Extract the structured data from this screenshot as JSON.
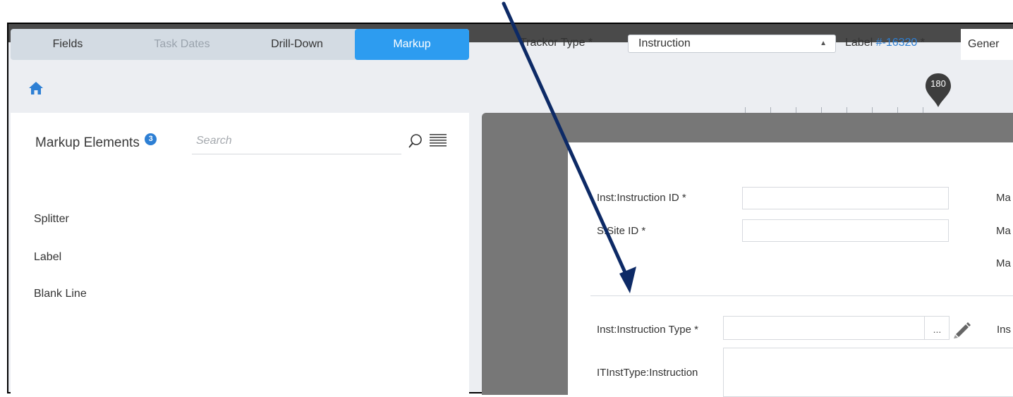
{
  "tabs": [
    {
      "label": "Fields"
    },
    {
      "label": "Task Dates"
    },
    {
      "label": "Drill-Down"
    },
    {
      "label": "Markup",
      "active": true
    }
  ],
  "toolbar": {
    "trackor_type_label": "Trackor Type *",
    "trackor_type_value": "Instruction",
    "label_prefix": "Label ",
    "label_id": "#-16320",
    "label_suffix": " *",
    "general_value": "Gener"
  },
  "ruler": {
    "marker_value": "180"
  },
  "markup_panel": {
    "title": "Markup Elements",
    "badge_count": "3",
    "search_placeholder": "Search",
    "elements": [
      "Splitter",
      "Label",
      "Blank Line"
    ]
  },
  "form": {
    "fields": [
      {
        "label": "Inst:Instruction ID *"
      },
      {
        "label": "S:Site ID *"
      },
      {
        "label": "Inst:Instruction Type *"
      },
      {
        "label": "ITInstType:Instruction"
      }
    ],
    "right_labels": [
      "Ma",
      "Ma",
      "Ma",
      "Ins"
    ],
    "ellipsis": "..."
  },
  "colors": {
    "accent": "#2d9cf0",
    "link": "#2d7fd4",
    "annotation_arrow": "#0d2a66"
  }
}
